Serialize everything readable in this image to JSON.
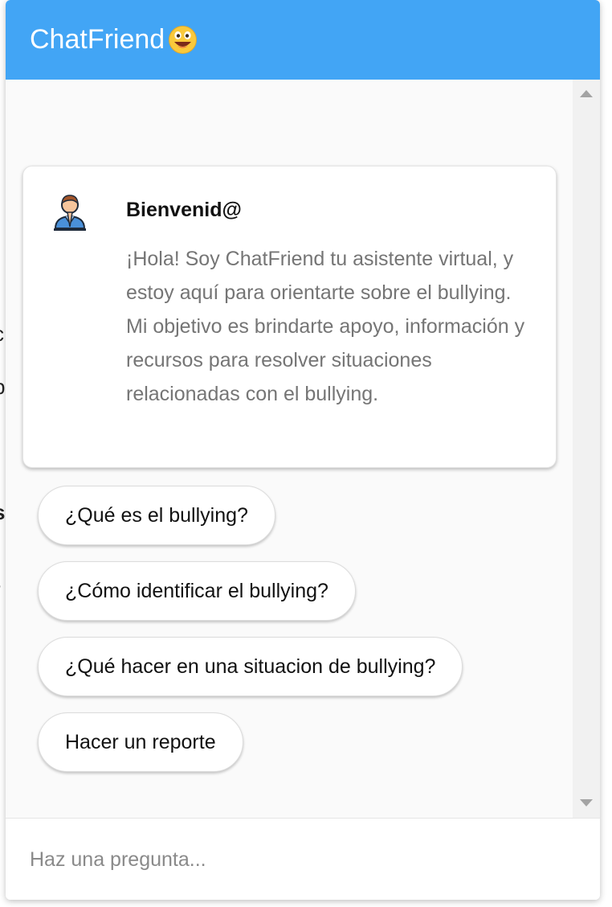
{
  "header": {
    "title": "ChatFriend",
    "emoji_icon": "grinning-face-emoji"
  },
  "card": {
    "avatar_icon": "person-praying-avatar",
    "title": "Bienvenid@",
    "text": "¡Hola! Soy ChatFriend tu asistente virtual, y estoy aquí para orientarte sobre el bullying. Mi objetivo es brindarte apoyo, información y recursos para resolver situaciones relacionadas con el bullying."
  },
  "options": [
    {
      "label": "¿Qué es el bullying?"
    },
    {
      "label": "¿Cómo identificar el bullying?"
    },
    {
      "label": "¿Qué hacer en una situacion de bullying?"
    },
    {
      "label": "Hacer un reporte"
    }
  ],
  "input": {
    "placeholder": "Haz una pregunta..."
  },
  "colors": {
    "header_bg": "#42a5f5",
    "panel_bg": "#fafafa"
  }
}
